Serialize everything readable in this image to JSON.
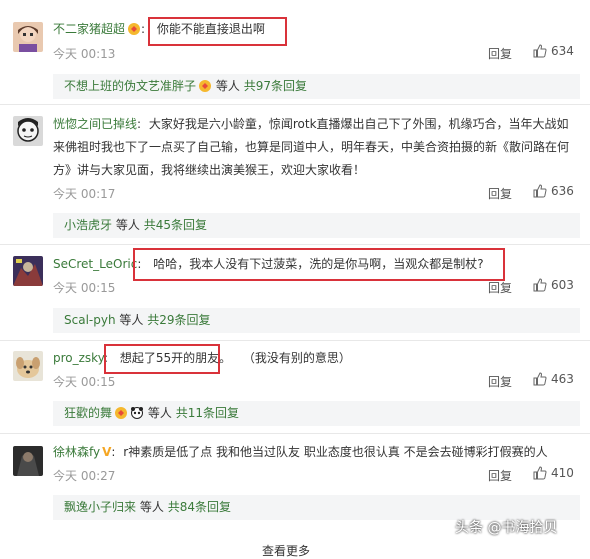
{
  "comments": [
    {
      "username": "不二家猪超超",
      "separator": ":",
      "text": "你能不能直接退出啊",
      "time": "今天 00:13",
      "reply_label": "回复",
      "likes": "634",
      "sub": {
        "user": "不想上班的伪文艺准胖子",
        "mid": "等人",
        "total": "共97条回复"
      }
    },
    {
      "username": "恍惚之间已掉线",
      "separator": ":",
      "text_line1": "大家好我是六小龄童，惊闻rotk直播爆出自己下了外围，机缘巧合，当年大战如",
      "text_line2": "来佛祖时我也下了一点买了自己输，也算是同道中人，明年春天，中美合资拍摄的新《散问路在何",
      "text_line3": "方》讲与大家见面，我将继续出演美猴王，欢迎大家收看！",
      "time": "今天 00:17",
      "reply_label": "回复",
      "likes": "636",
      "sub": {
        "user": "小浩虎牙",
        "mid": "等人",
        "total": "共45条回复"
      }
    },
    {
      "username": "SeCret_LeOric",
      "separator": ":",
      "text": "哈哈，我本人没有下过菠菜，洗的是你马啊，当观众都是制杖?",
      "time": "今天 00:15",
      "reply_label": "回复",
      "likes": "603",
      "sub": {
        "user": "Scal-pyh",
        "mid": "等人",
        "total": "共29条回复"
      }
    },
    {
      "username": "pro_zsky",
      "separator": ":",
      "text": "想起了55开的朋友。",
      "text_extra": "（我没有别的意思）",
      "time": "今天 00:15",
      "reply_label": "回复",
      "likes": "463",
      "sub": {
        "user": "狂歡的舞",
        "mid": "等人",
        "total": "共11条回复"
      }
    },
    {
      "username": "徐林森fy",
      "separator": ":",
      "text": "r神素质是低了点 我和他当过队友 职业态度也很认真 不是会去碰博彩打假赛的人",
      "time": "今天 00:27",
      "reply_label": "回复",
      "likes": "410",
      "sub": {
        "user": "飘逸小子归来",
        "mid": "等人",
        "total": "共84条回复"
      }
    }
  ],
  "watermark": "头条 @书海拾贝",
  "bottom_more": "查看更多",
  "colors": {
    "username": "#3a7a3a",
    "highlight_box": "#d9323a",
    "sub_bg": "#f4f5f6"
  }
}
